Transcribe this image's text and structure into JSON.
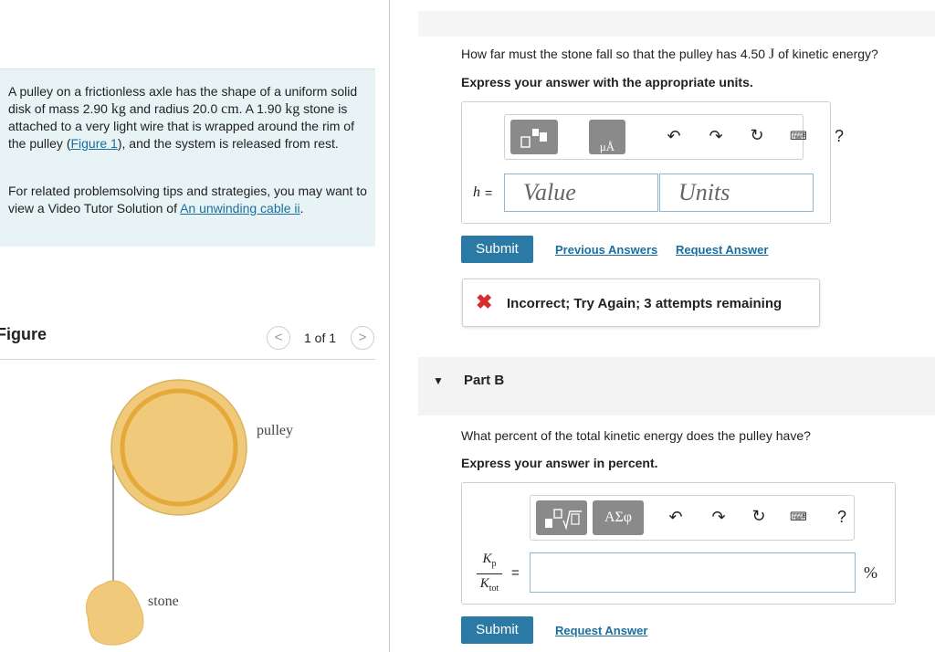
{
  "intro": {
    "p1_part1": "A pulley on a frictionless axle has the shape of a uniform solid disk of mass 2.90 ",
    "unit_kg": "kg",
    "p1_part2": " and radius 20.0 ",
    "unit_cm": "cm",
    "p1_part3": ". A 1.90 ",
    "unit_kg2": "kg",
    "p1_part4": " stone is attached to a very light wire that is wrapped around the rim of the pulley (",
    "figure_link": "Figure 1",
    "p1_part5": "), and the system is released from rest.",
    "p2_text": "For related problemsolving tips and strategies, you may want to view a Video Tutor Solution of ",
    "p2_link": "An unwinding cable ii",
    "p2_end": "."
  },
  "figure": {
    "title": "Figure",
    "pager": "1 of 1",
    "prev_glyph": "<",
    "next_glyph": ">",
    "label_pulley": "pulley",
    "label_stone": "stone"
  },
  "part_a": {
    "question_pre": "How far must the stone fall so that the pulley has 4.50 ",
    "question_unit": "J",
    "question_post": " of kinetic energy?",
    "instruction": "Express your answer with the appropriate units.",
    "var_label": "h",
    "equals": "=",
    "value_placeholder": "Value",
    "units_placeholder": "Units",
    "submit": "Submit",
    "previous_answers": "Previous Answers",
    "request_answer": "Request Answer",
    "feedback": "Incorrect; Try Again; 3 attempts remaining"
  },
  "part_b": {
    "title": "Part B",
    "question": "What percent of the total kinetic energy does the pulley have?",
    "instruction": "Express your answer in percent.",
    "greek_button": "ΑΣφ",
    "kp": "K",
    "kp_sub": "p",
    "ktot": "K",
    "ktot_sub": "tot",
    "equals": "=",
    "unit": "%",
    "submit": "Submit",
    "request_answer": "Request Answer"
  },
  "toolbar": {
    "undo": "↶",
    "redo": "↷",
    "reset": "↻",
    "keyboard": "⌨",
    "help": "?",
    "caret": "▼",
    "x_mark": "✖"
  },
  "colors": {
    "accent": "#2a7aa5",
    "intro_bg": "#e8f3f5",
    "pulley_fill": "#f1c97a",
    "pulley_ring": "#e5a93a",
    "error": "#d62e2e"
  }
}
